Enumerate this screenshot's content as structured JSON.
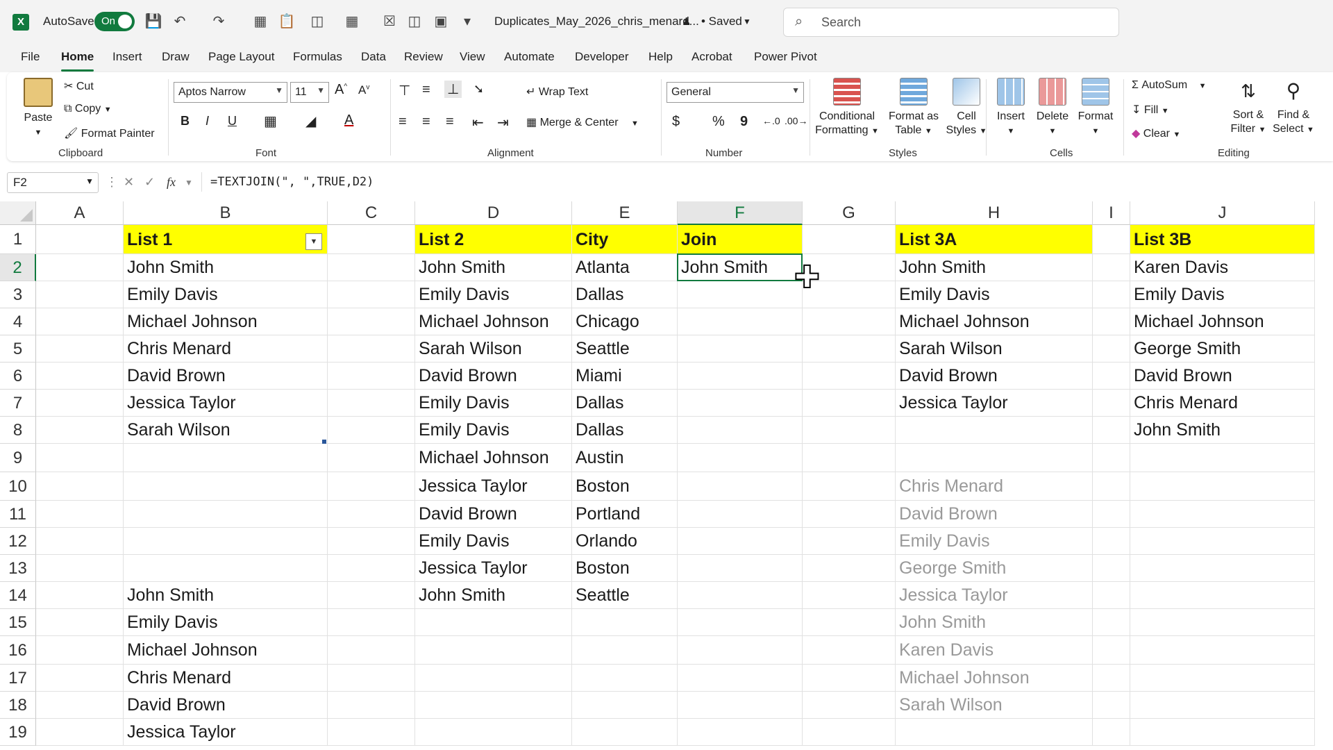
{
  "titlebar": {
    "autosave_label": "AutoSave",
    "autosave_state": "On",
    "filename": "Duplicates_May_2026_chris_menard...",
    "saved": "• Saved",
    "search_placeholder": "Search"
  },
  "menu": [
    "File",
    "Home",
    "Insert",
    "Draw",
    "Page Layout",
    "Formulas",
    "Data",
    "Review",
    "View",
    "Automate",
    "Developer",
    "Help",
    "Acrobat",
    "Power Pivot"
  ],
  "menu_active": "Home",
  "ribbon": {
    "clipboard": {
      "paste": "Paste",
      "cut": "Cut",
      "copy": "Copy",
      "format_painter": "Format Painter",
      "label": "Clipboard"
    },
    "font": {
      "name": "Aptos Narrow",
      "size": "11",
      "bold": "B",
      "italic": "I",
      "underline": "U",
      "label": "Font"
    },
    "alignment": {
      "wrap": "Wrap Text",
      "merge": "Merge & Center",
      "label": "Alignment"
    },
    "number": {
      "format": "General",
      "currency": "$",
      "percent": "%",
      "comma": "9",
      "label": "Number"
    },
    "styles": {
      "conditional": "Conditional",
      "formatting": "Formatting",
      "format_as": "Format as",
      "table": "Table",
      "cell": "Cell",
      "cell_styles": "Styles",
      "label": "Styles"
    },
    "cells": {
      "insert": "Insert",
      "delete": "Delete",
      "format": "Format",
      "label": "Cells"
    },
    "editing": {
      "autosum": "AutoSum",
      "fill": "Fill",
      "clear": "Clear",
      "sort": "Sort &",
      "filter": "Filter",
      "find": "Find &",
      "select": "Select",
      "label": "Editing"
    }
  },
  "formula_bar": {
    "name_box": "F2",
    "formula": "=TEXTJOIN(\", \",TRUE,D2)"
  },
  "columns": [
    "A",
    "B",
    "C",
    "D",
    "E",
    "F",
    "G",
    "H",
    "I",
    "J"
  ],
  "selected_column": "F",
  "rows": [
    "1",
    "2",
    "3",
    "4",
    "5",
    "6",
    "7",
    "8",
    "9",
    "10",
    "11",
    "12",
    "13",
    "14",
    "15",
    "16",
    "17",
    "18",
    "19"
  ],
  "selected_row": "2",
  "sheet": {
    "B": [
      "List 1",
      "John Smith",
      "Emily Davis",
      "Michael Johnson",
      "Chris Menard",
      "David Brown",
      "Jessica Taylor",
      "Sarah Wilson",
      "",
      "",
      "",
      "",
      "",
      "John Smith",
      "Emily Davis",
      "Michael Johnson",
      "Chris Menard",
      "David Brown",
      "Jessica Taylor"
    ],
    "D": [
      "List 2",
      "John Smith",
      "Emily Davis",
      "Michael Johnson",
      "Sarah Wilson",
      "David Brown",
      "Emily Davis",
      "Emily Davis",
      "Michael Johnson",
      "Jessica Taylor",
      "David Brown",
      "Emily Davis",
      "Jessica Taylor",
      "John Smith",
      "",
      "",
      "",
      "",
      ""
    ],
    "E": [
      "City",
      "Atlanta",
      "Dallas",
      "Chicago",
      "Seattle",
      "Miami",
      "Dallas",
      "Dallas",
      "Austin",
      "Boston",
      "Portland",
      "Orlando",
      "Boston",
      "Seattle",
      "",
      "",
      "",
      "",
      ""
    ],
    "F": [
      "Join",
      "John Smith",
      "",
      "",
      "",
      "",
      "",
      "",
      "",
      "",
      "",
      "",
      "",
      "",
      "",
      "",
      "",
      "",
      ""
    ],
    "H": [
      "List 3A",
      "John Smith",
      "Emily Davis",
      "Michael Johnson",
      "Sarah Wilson",
      "David Brown",
      "Jessica Taylor",
      "",
      "",
      "Chris Menard",
      "David Brown",
      "Emily Davis",
      "George Smith",
      "Jessica Taylor",
      "John Smith",
      "Karen Davis",
      "Michael Johnson",
      "Sarah Wilson",
      ""
    ],
    "J": [
      "List 3B",
      "Karen Davis",
      "Emily Davis",
      "Michael Johnson",
      "George Smith",
      "David Brown",
      "Chris Menard",
      "John Smith",
      "",
      "",
      "",
      "",
      "",
      "",
      "",
      "",
      "",
      "",
      ""
    ]
  },
  "colors": {
    "accent": "#117a3e",
    "header_fill": "#ffff00",
    "faded_text": "#999999"
  }
}
